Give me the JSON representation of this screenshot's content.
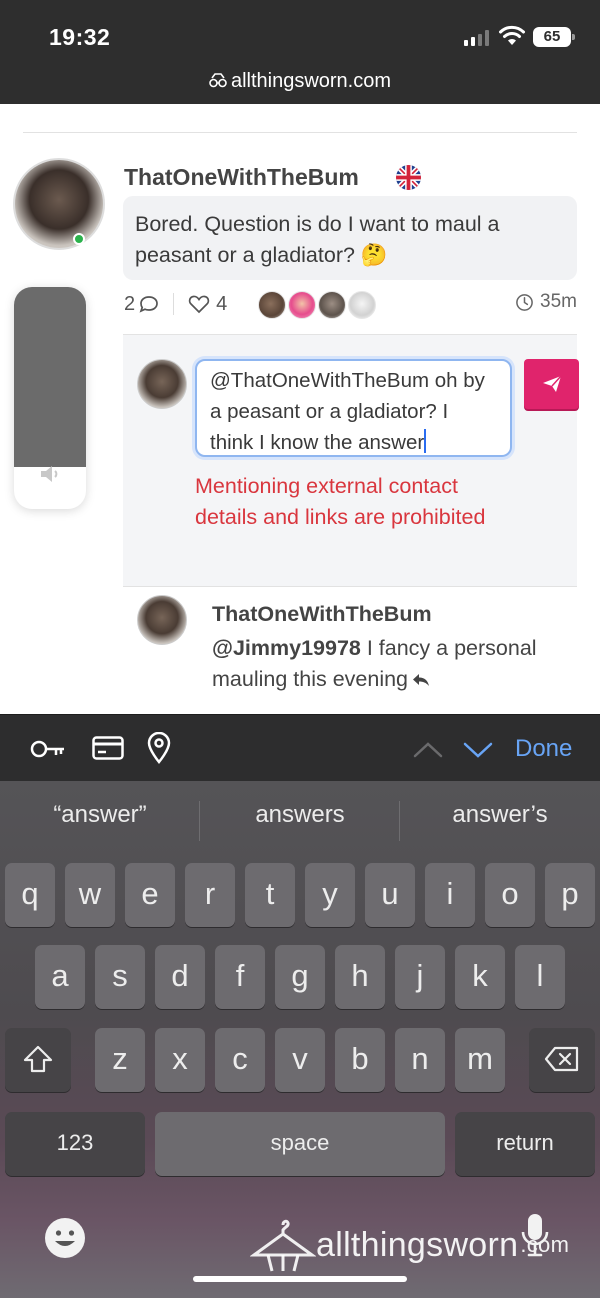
{
  "status_bar": {
    "time": "19:32",
    "battery": "65"
  },
  "browser": {
    "url": "allthingsworn.com"
  },
  "post": {
    "author": "ThatOneWithTheBum",
    "text": "Bored. Question is do I want to maul a peasant or a gladiator? 🤔",
    "comment_count": "2",
    "like_count": "4",
    "time_ago": "35m"
  },
  "reply_form": {
    "draft": "@ThatOneWithTheBum oh by a peasant or a gladiator? I think I know the answer",
    "error": "Mentioning external contact details and links are prohibited"
  },
  "comment": {
    "author": "ThatOneWithTheBum",
    "mention": "@Jimmy19978",
    "text": " I fancy a personal mauling this evening"
  },
  "volume": {
    "level": 0.19
  },
  "keyboard": {
    "done_label": "Done",
    "suggestions": [
      "“answer”",
      "answers",
      "answer’s"
    ],
    "row1": [
      "q",
      "w",
      "e",
      "r",
      "t",
      "y",
      "u",
      "i",
      "o",
      "p"
    ],
    "row2": [
      "a",
      "s",
      "d",
      "f",
      "g",
      "h",
      "j",
      "k",
      "l"
    ],
    "row3": [
      "z",
      "x",
      "c",
      "v",
      "b",
      "n",
      "m"
    ],
    "numbers_label": "123",
    "space_label": "space",
    "return_label": "return"
  },
  "watermark": {
    "brand": "allthingsworn",
    "suffix": ".com"
  },
  "colors": {
    "accent": "#e0246c",
    "error": "#d9363e",
    "link": "#68a4f5",
    "online": "#2bb24c"
  }
}
